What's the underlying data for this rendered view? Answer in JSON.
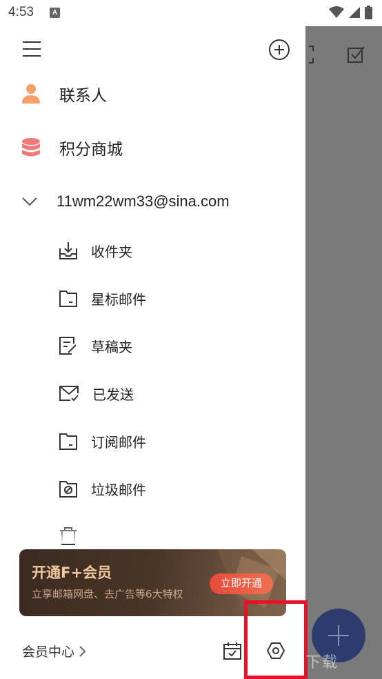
{
  "status_bar": {
    "time": "4:53",
    "notif_badge": "A"
  },
  "drawer": {
    "nav": {
      "contacts": "联系人",
      "points_mall": "积分商城"
    },
    "account": {
      "email": "11wm22wm33@sina.com"
    },
    "folders": [
      {
        "label": "收件夹",
        "icon": "inbox-icon"
      },
      {
        "label": "星标邮件",
        "icon": "folder-icon"
      },
      {
        "label": "草稿夹",
        "icon": "draft-icon"
      },
      {
        "label": "已发送",
        "icon": "sent-icon"
      },
      {
        "label": "订阅邮件",
        "icon": "folder-icon"
      },
      {
        "label": "垃圾邮件",
        "icon": "spam-folder-icon"
      }
    ],
    "promo": {
      "title": "开通F+会员",
      "subtitle": "立享邮箱网盘、去广告等6大特权",
      "button": "立即开通"
    },
    "footer": {
      "member_center": "会员中心"
    }
  },
  "watermark": "一听下载",
  "colors": {
    "contacts_icon": "#f5a06a",
    "mall_icon": "#f07a78",
    "promo_button": "#e74a3a",
    "highlight": "#e8112a",
    "fab": "#2c3c6e"
  }
}
